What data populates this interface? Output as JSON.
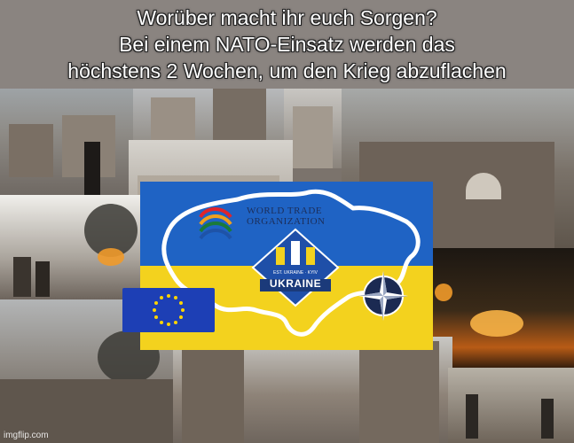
{
  "caption": {
    "line1": "Worüber macht ihr euch Sorgen?",
    "line2": "Bei einem NATO-Einsatz werden das",
    "line3": "höchstens 2 Wochen, um den Krieg abzuflachen"
  },
  "logos": {
    "wto_line1": "WORLD TRADE",
    "wto_line2": "ORGANIZATION",
    "badge_small": "EST. UKRAINE · KYIV",
    "badge_label": "UKRAINE"
  },
  "watermark": "imgflip.com",
  "colors": {
    "ukraine_blue": "#1f63c4",
    "ukraine_yellow": "#f3d21e",
    "eu_blue": "#1d3fb5",
    "nato_navy": "#1b2a52",
    "caption_bg": "#8a8480"
  }
}
